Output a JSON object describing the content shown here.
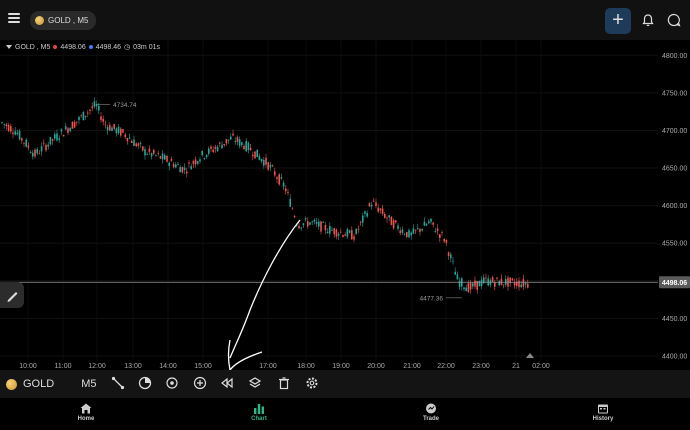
{
  "header": {
    "symbol_pill": "GOLD , M5",
    "add_button": "+"
  },
  "legend": {
    "symbol": "GOLD , M5",
    "bid": "4498.06",
    "ask": "4498.46",
    "timer": "03m 01s",
    "bid_color": "#e0463f",
    "ask_color": "#3b82f6"
  },
  "chart_data": {
    "type": "candlestick",
    "price_labels": [
      "4800.00",
      "4750.00",
      "4700.00",
      "4650.00",
      "4600.00",
      "4550.00",
      "4500.00",
      "4450.00",
      "4400.00"
    ],
    "time_labels": [
      "10:00",
      "11:00",
      "12:00",
      "13:00",
      "14:00",
      "15:00",
      "17:00",
      "18:00",
      "19:00",
      "20:00",
      "21:00",
      "22:00",
      "23:00",
      "21",
      "02:00"
    ],
    "current_price": "4498.06",
    "high_annotation": "4734.74",
    "low_annotation": "4477.36",
    "ylim": [
      4392,
      4815
    ],
    "up_color": "#26a69a",
    "down_color": "#ef5350"
  },
  "toolbar": {
    "symbol": "GOLD",
    "timeframe": "M5"
  },
  "nav": {
    "home": "Home",
    "chart": "Chart",
    "trade": "Trade",
    "history": "History",
    "active_color": "#2fb58a"
  }
}
